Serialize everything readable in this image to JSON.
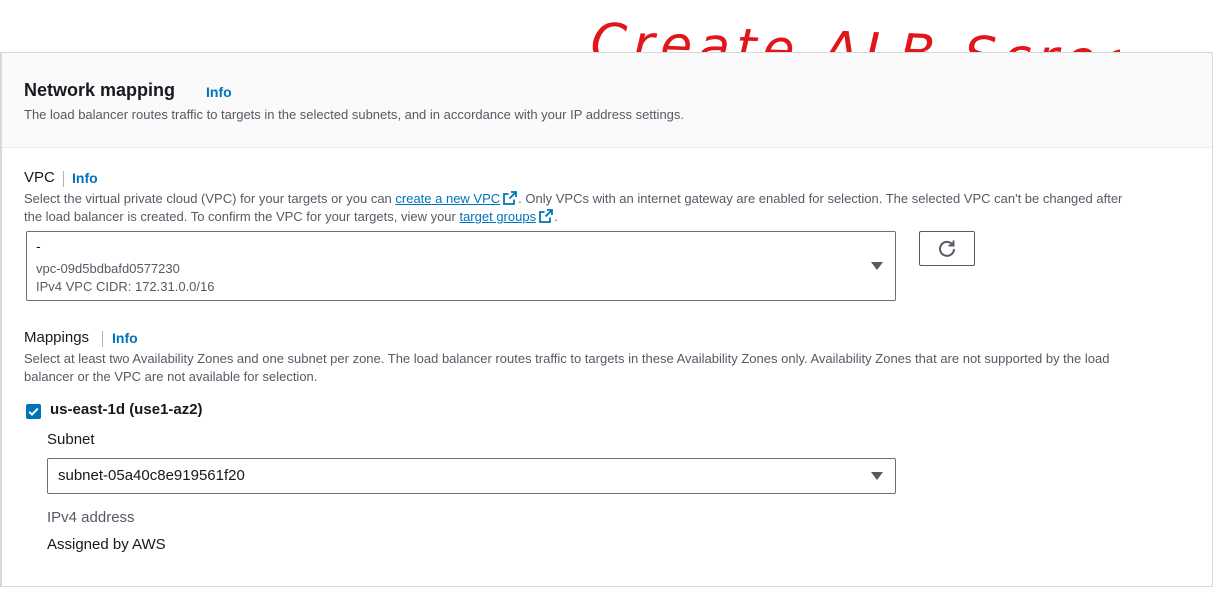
{
  "annotation": {
    "text": "Create ALB Screen",
    "color": "#e0161b"
  },
  "section": {
    "title": "Network mapping",
    "info": "Info",
    "description": "The load balancer routes traffic to targets in the selected subnets, and in accordance with your IP address settings."
  },
  "vpc": {
    "label": "VPC",
    "info": "Info",
    "desc_part1": "Select the virtual private cloud (VPC) for your targets or you can ",
    "create_link": "create a new VPC",
    "desc_part2": ". Only VPCs with an internet gateway are enabled for selection. The selected VPC can't be changed after",
    "desc_line2_part1": "the load balancer is created. To confirm the VPC for your targets, view your ",
    "target_groups_link": "target groups",
    "desc_line2_part2": ".",
    "selected_name": "-",
    "selected_id": "vpc-09d5bdbafd0577230",
    "selected_cidr": "IPv4 VPC CIDR: 172.31.0.0/16"
  },
  "mappings": {
    "label": "Mappings",
    "info": "Info",
    "desc_line1": "Select at least two Availability Zones and one subnet per zone. The load balancer routes traffic to targets in these Availability Zones only. Availability Zones that are not supported by the load",
    "desc_line2": "balancer or the VPC are not available for selection.",
    "zones": [
      {
        "name": "us-east-1d (use1-az2)",
        "checked": true,
        "subnet_label": "Subnet",
        "subnet_value": "subnet-05a40c8e919561f20",
        "ipv4_label": "IPv4 address",
        "ipv4_value": "Assigned by AWS"
      }
    ]
  },
  "colors": {
    "link": "#0073bb",
    "checkbox": "#0073bb",
    "text": "#16191f",
    "muted": "#545b64"
  }
}
